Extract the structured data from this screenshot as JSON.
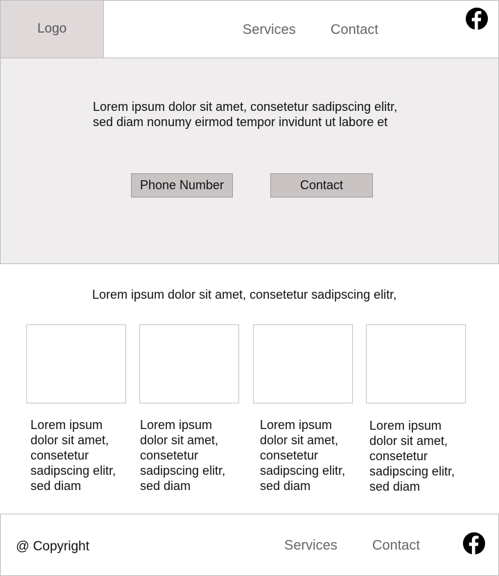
{
  "header": {
    "logo": "Logo",
    "nav": [
      "Services",
      "Contact"
    ],
    "social_icon": "facebook-icon"
  },
  "hero": {
    "text_line1": "Lorem ipsum dolor sit amet, consetetur sadipscing elitr,",
    "text_line2": "sed diam nonumy eirmod tempor invidunt ut labore et",
    "phone_button": "Phone Number",
    "contact_button": "Contact"
  },
  "services": {
    "title": "Lorem ipsum dolor sit amet, consetetur sadipscing elitr,",
    "cards": [
      {
        "lines": [
          "Lorem ipsum",
          "dolor sit amet,",
          "consetetur",
          "sadipscing elitr,",
          "sed diam"
        ]
      },
      {
        "lines": [
          "Lorem ipsum",
          "dolor sit amet,",
          "consetetur",
          "sadipscing elitr,",
          "sed diam"
        ]
      },
      {
        "lines": [
          "Lorem ipsum",
          "dolor sit amet,",
          "consetetur",
          "sadipscing elitr,",
          "sed diam"
        ]
      },
      {
        "lines": [
          "Lorem ipsum",
          "dolor sit amet,",
          "consetetur",
          "sadipscing elitr,",
          "sed diam"
        ]
      }
    ]
  },
  "footer": {
    "copyright": "@ Copyright",
    "nav": [
      "Services",
      "Contact"
    ],
    "social_icon": "facebook-icon"
  }
}
